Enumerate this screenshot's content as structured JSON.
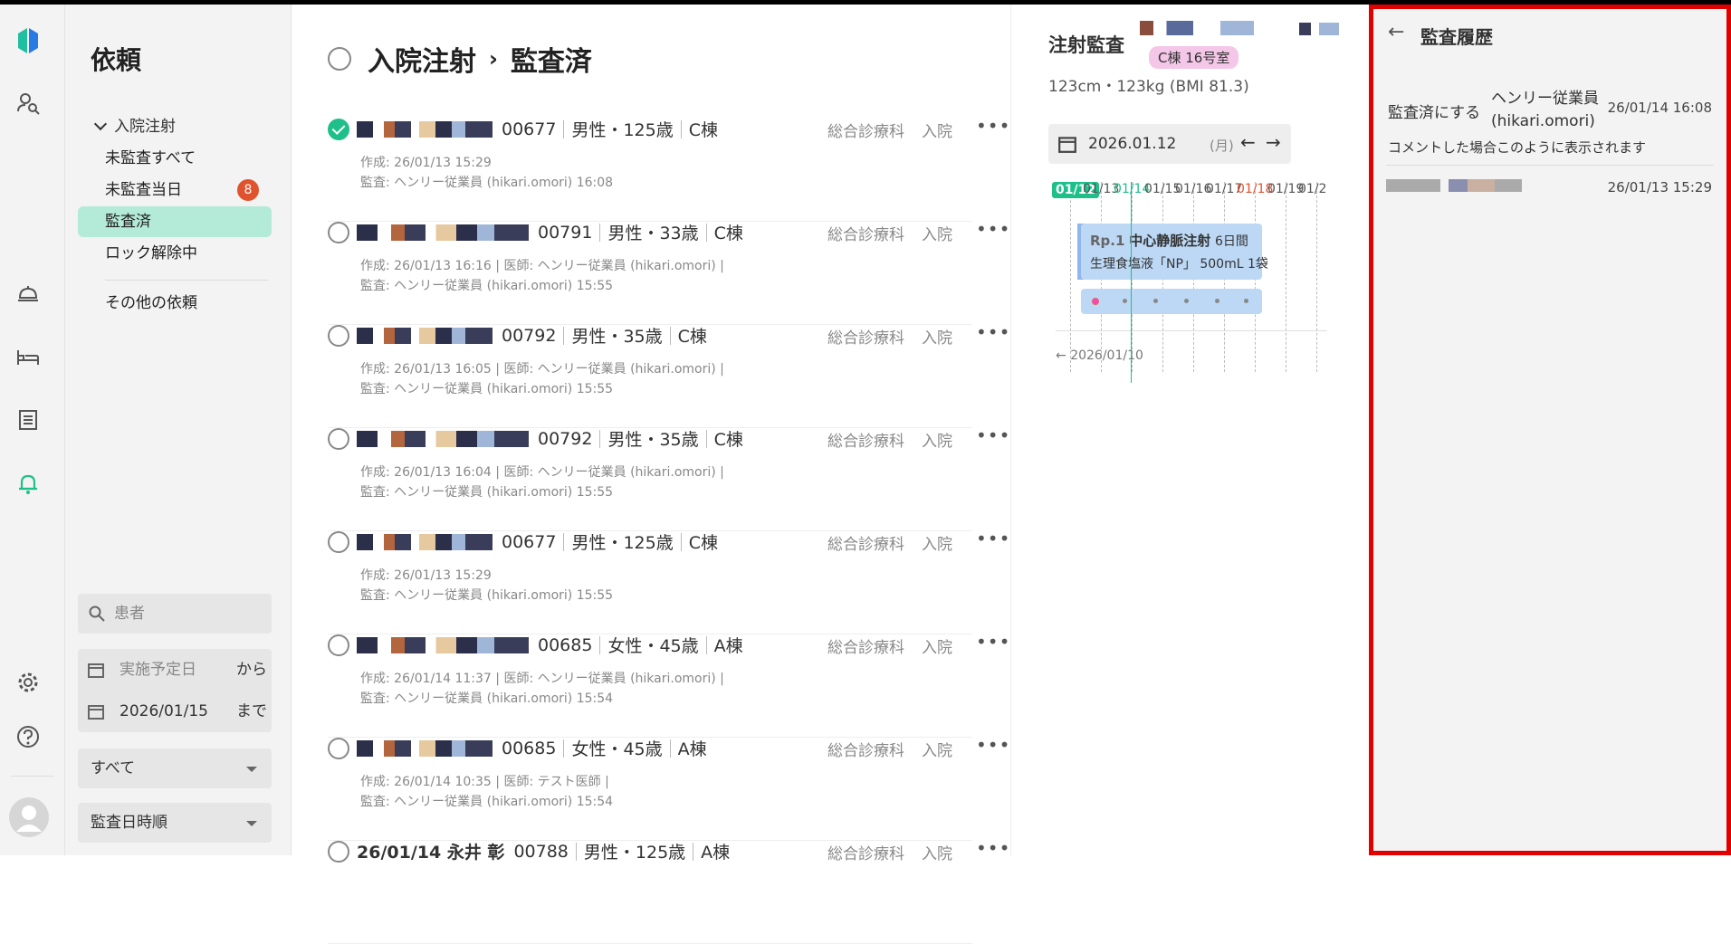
{
  "nav": {
    "title": "依頼",
    "group": "入院注射",
    "items": [
      {
        "label": "未監査すべて"
      },
      {
        "label": "未監査当日",
        "badge": "8"
      },
      {
        "label": "監査済"
      },
      {
        "label": "ロック解除中"
      },
      {
        "label": "その他の依頼"
      }
    ],
    "search_placeholder": "患者",
    "date_from_placeholder": "実施予定日",
    "from_label": "から",
    "date_to": "2026/01/15",
    "to_label": "まで",
    "filter_select": "すべて",
    "sort_select": "監査日時順"
  },
  "list": {
    "breadcrumb_root": "入院注射",
    "breadcrumb_current": "監査済",
    "rows": [
      {
        "checked": true,
        "id": "00677",
        "sex_age": "男性・125歳",
        "ward": "C棟",
        "dept": "総合診療科",
        "kind": "入院",
        "created": "作成: 26/01/13 15:29",
        "audit": "監査: ヘンリー従業員 (hikari.omori) 16:08"
      },
      {
        "checked": false,
        "id": "00791",
        "sex_age": "男性・33歳",
        "ward": "C棟",
        "dept": "総合診療科",
        "kind": "入院",
        "created": "作成: 26/01/13 16:16 | 医師: ヘンリー従業員 (hikari.omori) |",
        "audit": "監査: ヘンリー従業員 (hikari.omori) 15:55"
      },
      {
        "checked": false,
        "id": "00792",
        "sex_age": "男性・35歳",
        "ward": "C棟",
        "dept": "総合診療科",
        "kind": "入院",
        "created": "作成: 26/01/13 16:05 | 医師: ヘンリー従業員 (hikari.omori) |",
        "audit": "監査: ヘンリー従業員 (hikari.omori) 15:55"
      },
      {
        "checked": false,
        "id": "00792",
        "sex_age": "男性・35歳",
        "ward": "C棟",
        "dept": "総合診療科",
        "kind": "入院",
        "created": "作成: 26/01/13 16:04 | 医師: ヘンリー従業員 (hikari.omori) |",
        "audit": "監査: ヘンリー従業員 (hikari.omori) 15:55"
      },
      {
        "checked": false,
        "id": "00677",
        "sex_age": "男性・125歳",
        "ward": "C棟",
        "dept": "総合診療科",
        "kind": "入院",
        "created": "作成: 26/01/13 15:29",
        "audit": "監査: ヘンリー従業員 (hikari.omori) 15:55"
      },
      {
        "checked": false,
        "id": "00685",
        "sex_age": "女性・45歳",
        "ward": "A棟",
        "dept": "総合診療科",
        "kind": "入院",
        "created": "作成: 26/01/14 11:37 | 医師: ヘンリー従業員 (hikari.omori) |",
        "audit": "監査: ヘンリー従業員 (hikari.omori) 15:54"
      },
      {
        "checked": false,
        "id": "00685",
        "sex_age": "女性・45歳",
        "ward": "A棟",
        "dept": "総合診療科",
        "kind": "入院",
        "created": "作成: 26/01/14 10:35 | 医師: テスト医師 |",
        "audit": "監査: ヘンリー従業員 (hikari.omori) 15:54"
      },
      {
        "checked": false,
        "name": "26/01/14 永井 彰",
        "id": "00788",
        "sex_age": "男性・125歳",
        "ward": "A棟",
        "dept": "総合診療科",
        "kind": "入院",
        "created": "",
        "audit": ""
      }
    ]
  },
  "detail": {
    "title": "注射監査",
    "room": "C棟 16号室",
    "body": "123cm・123kg (BMI 81.3)",
    "date": "2026.01.12",
    "weekday": "(月)",
    "timeline_dates": [
      "01/12",
      "01/13",
      "01/14",
      "01/15",
      "01/16",
      "01/17",
      "01/18",
      "01/19",
      "01/2"
    ],
    "rp_label": "Rp.1",
    "rp_name": "中心静脈注射",
    "rp_days": "6日間",
    "rp_drug": "生理食塩液「NP」 500mL 1袋",
    "prev_date": "2026/01/10"
  },
  "history": {
    "title": "監査履歴",
    "entry1_action": "監査済にする",
    "entry1_user": "ヘンリー従業員",
    "entry1_user_id": "(hikari.omori)",
    "entry1_date": "26/01/14 16:08",
    "entry1_comment": "コメントした場合このように表示されます",
    "entry2_date": "26/01/13 15:29"
  },
  "colors": {
    "accent": "#1fbf8a",
    "active_nav": "#b3ead8",
    "badge": "#e0532f",
    "highlight_border": "#e00000"
  }
}
